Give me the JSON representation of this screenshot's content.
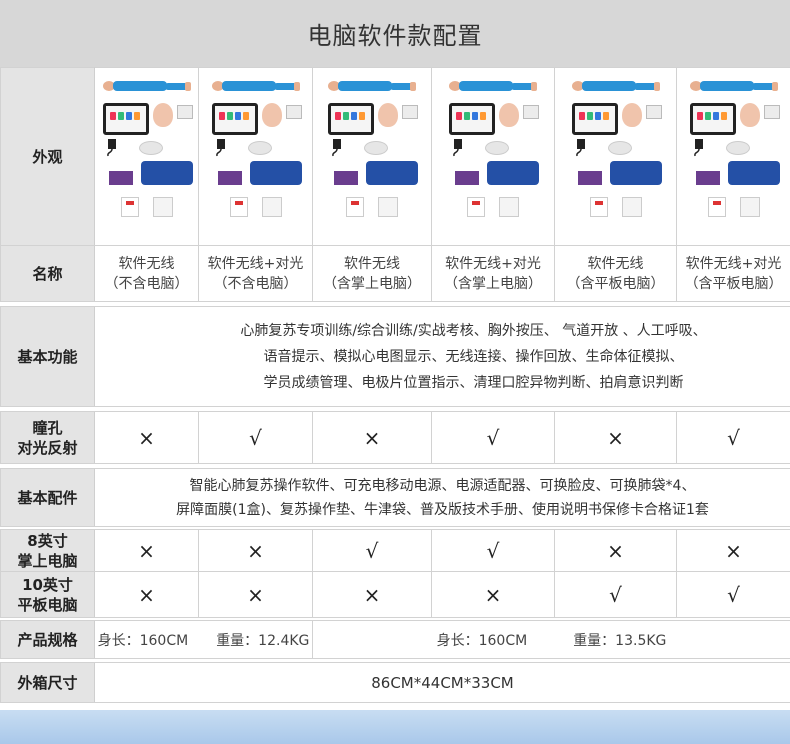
{
  "title": "电脑软件款配置",
  "labels": {
    "appearance": "外观",
    "name": "名称",
    "basic_functions": "基本功能",
    "pupil": [
      "瞳孔",
      "对光反射"
    ],
    "accessories": "基本配件",
    "handheld": [
      "8英寸",
      "掌上电脑"
    ],
    "tablet": [
      "10英寸",
      "平板电脑"
    ],
    "spec": "产品规格",
    "box_size": "外箱尺寸"
  },
  "products": [
    {
      "name": [
        "软件无线",
        "（不含电脑）"
      ],
      "pupil": "×",
      "handheld": "×",
      "tablet": "×"
    },
    {
      "name": [
        "软件无线+对光",
        "（不含电脑）"
      ],
      "pupil": "√",
      "handheld": "×",
      "tablet": "×"
    },
    {
      "name": [
        "软件无线",
        "（含掌上电脑）"
      ],
      "pupil": "×",
      "handheld": "√",
      "tablet": "×"
    },
    {
      "name": [
        "软件无线+对光",
        "（含掌上电脑）"
      ],
      "pupil": "√",
      "handheld": "√",
      "tablet": "×"
    },
    {
      "name": [
        "软件无线",
        "（含平板电脑）"
      ],
      "pupil": "×",
      "handheld": "×",
      "tablet": "√"
    },
    {
      "name": [
        "软件无线+对光",
        "（含平板电脑）"
      ],
      "pupil": "√",
      "handheld": "×",
      "tablet": "√"
    }
  ],
  "basic_functions": [
    "心肺复苏专项训练/综合训练/实战考核、胸外按压、 气道开放 、人工呼吸、",
    "语音提示、模拟心电图显示、无线连接、操作回放、生命体征模拟、",
    "学员成绩管理、电极片位置指示、清理口腔异物判断、拍肩意识判断"
  ],
  "accessories": [
    "智能心肺复苏操作软件、可充电移动电源、电源适配器、可换脸皮、可换肺袋*4、",
    "屏障面膜(1盒)、复苏操作垫、牛津袋、普及版技术手册、使用说明书保修卡合格证1套"
  ],
  "spec": {
    "left": {
      "height": "身长：160CM",
      "weight": "重量：12.4KG"
    },
    "right": {
      "height": "身长：160CM",
      "weight": "重量：13.5KG"
    }
  },
  "box_size": "86CM*44CM*33CM",
  "colors": {
    "label_bg": "#e4e4e4",
    "title_bg": "#d7d7d7",
    "manikin_blue": "#2a92d6",
    "bag_blue": "#2450a6",
    "pad_purple": "#6a3d8e",
    "footer_blue": "#a9c8ea"
  },
  "icons": {
    "yes": "check-mark-icon",
    "no": "cross-mark-icon"
  }
}
